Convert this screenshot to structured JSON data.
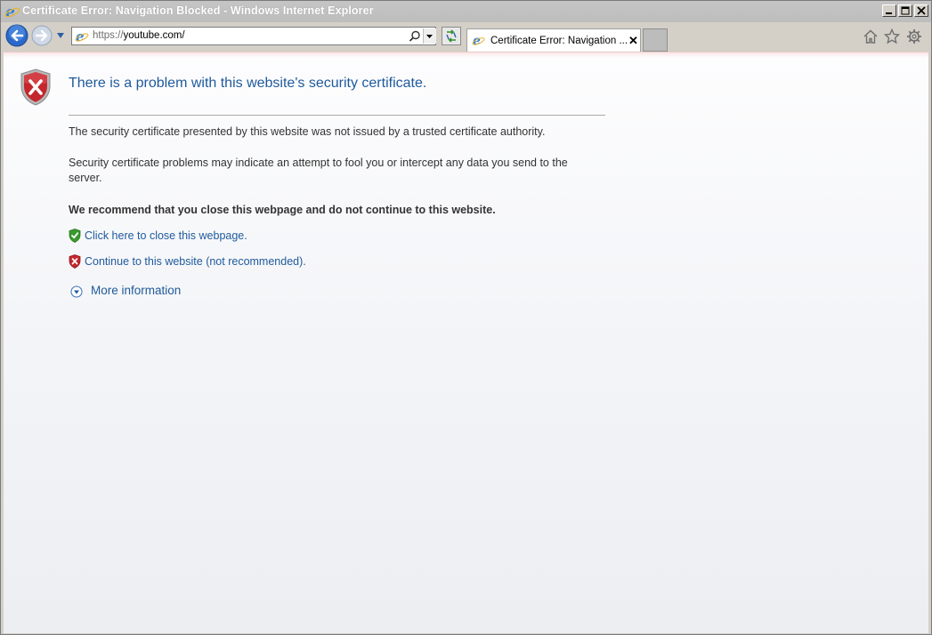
{
  "window": {
    "title": "Certificate Error: Navigation Blocked - Windows Internet Explorer"
  },
  "address_bar": {
    "url_scheme": "https://",
    "url_host": "youtube.com/"
  },
  "tabs": [
    {
      "label": "Certificate Error: Navigation ...",
      "close_label": "✕"
    }
  ],
  "page": {
    "heading": "There is a problem with this website's security certificate.",
    "paragraph_1": "The security certificate presented by this website was not issued by a trusted certificate authority.",
    "paragraph_2": "Security certificate problems may indicate an attempt to fool you or intercept any data you send to the server.",
    "recommendation": "We recommend that you close this webpage and do not continue to this website.",
    "close_link": "Click here to close this webpage.",
    "continue_link": "Continue to this website (not recommended).",
    "more_info": "More information"
  },
  "colors": {
    "link_blue": "#1f5a9b",
    "shield_red": "#c0272d",
    "shield_green": "#3a9a2f"
  },
  "icons": [
    "ie-logo-icon",
    "back-arrow-icon",
    "forward-arrow-icon",
    "search-icon",
    "refresh-icon",
    "home-icon",
    "favorites-star-icon",
    "gear-icon",
    "shield-error-icon",
    "shield-green-icon",
    "shield-red-icon",
    "expand-circle-icon"
  ]
}
